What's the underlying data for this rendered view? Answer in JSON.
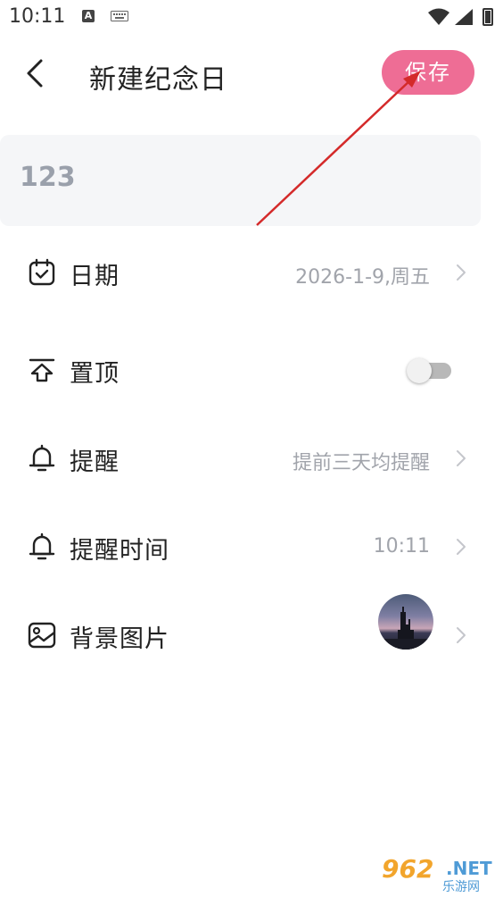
{
  "status_bar": {
    "time": "10:11",
    "indicator_a": "A"
  },
  "header": {
    "title": "新建纪念日",
    "save_label": "保存"
  },
  "name_input": {
    "value": "123"
  },
  "rows": [
    {
      "label": "日期",
      "value": "2026-1-9,周五",
      "icon": "calendar-check-icon"
    },
    {
      "label": "置顶",
      "toggle_on": false,
      "icon": "pin-top-icon"
    },
    {
      "label": "提醒",
      "value": "提前三天均提醒",
      "icon": "bell-icon"
    },
    {
      "label": "提醒时间",
      "value": "10:11",
      "icon": "bell-icon"
    },
    {
      "label": "背景图片",
      "icon": "image-icon"
    }
  ],
  "watermark": {
    "number": "962",
    "suffix": ".NET",
    "cn": "乐游网"
  },
  "colors": {
    "accent": "#ee6d95",
    "value_text": "#a1a4ab",
    "card_bg": "#f5f6f8"
  }
}
